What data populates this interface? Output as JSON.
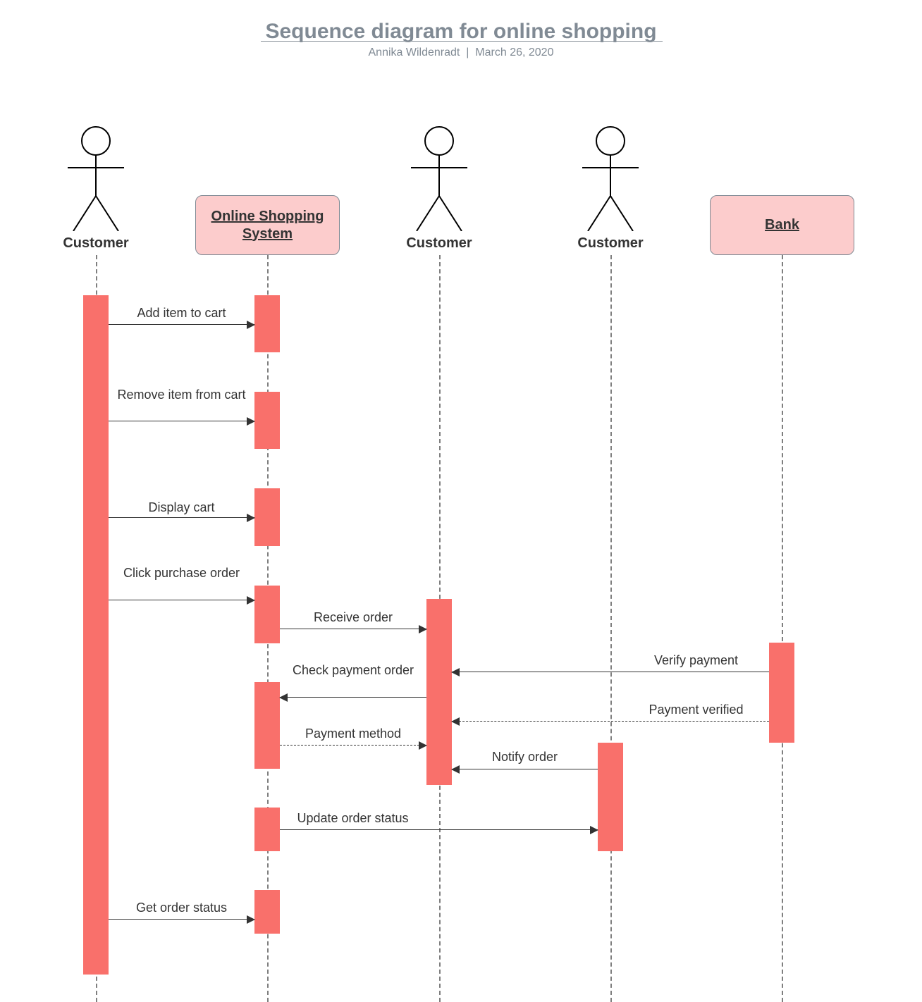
{
  "title": "Sequence diagram for online shopping",
  "author": "Annika Wildenradt",
  "date": "March 26, 2020",
  "participants": {
    "p1": {
      "label": "Customer",
      "kind": "actor"
    },
    "p2": {
      "label": "Online Shopping System",
      "kind": "object"
    },
    "p3": {
      "label": "Customer",
      "kind": "actor"
    },
    "p4": {
      "label": "Customer",
      "kind": "actor"
    },
    "p5": {
      "label": "Bank",
      "kind": "object"
    }
  },
  "messages": {
    "m1": {
      "text": "Add item to cart",
      "from": "p1",
      "to": "p2",
      "style": "solid"
    },
    "m2": {
      "text": "Remove item from cart",
      "from": "p1",
      "to": "p2",
      "style": "solid"
    },
    "m3": {
      "text": "Display cart",
      "from": "p1",
      "to": "p2",
      "style": "solid"
    },
    "m4": {
      "text": "Click purchase order",
      "from": "p1",
      "to": "p2",
      "style": "solid"
    },
    "m5": {
      "text": "Receive order",
      "from": "p2",
      "to": "p3",
      "style": "solid"
    },
    "m6": {
      "text": "Check payment order",
      "from": "p3",
      "to": "p2",
      "style": "solid"
    },
    "m7": {
      "text": "Payment method",
      "from": "p2",
      "to": "p3",
      "style": "dashed"
    },
    "m8a": {
      "text": "Verify payment",
      "from": "p5",
      "to": "p3",
      "style": "solid"
    },
    "m8b": {
      "text": "Payment verified",
      "from": "p5",
      "to": "p3",
      "style": "dashed"
    },
    "m8c": {
      "text": "Notify order",
      "from": "p4",
      "to": "p3",
      "style": "solid"
    },
    "m9": {
      "text": "Update order status",
      "from": "p2",
      "to": "p4",
      "style": "solid"
    },
    "m10": {
      "text": "Get order status",
      "from": "p1",
      "to": "p2",
      "style": "solid"
    }
  },
  "colors": {
    "box_fill": "#fccccc",
    "bar_fill": "#f9706b",
    "header_text": "#808a94"
  }
}
